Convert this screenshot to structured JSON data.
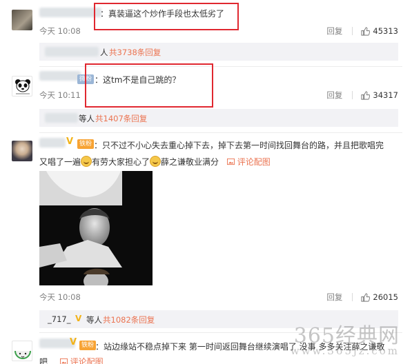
{
  "comments": [
    {
      "text": "：真装逼这个炒作手段也太低劣了",
      "timestamp": "今天 10:08",
      "reply_label": "回复",
      "likes": "45313",
      "subreply": {
        "prefix": "人",
        "count_text": "共3738条回复"
      }
    },
    {
      "badge": "微粉",
      "text": "：这tm不是自己跳的？",
      "timestamp": "今天 10:11",
      "reply_label": "回复",
      "likes": "34317",
      "subreply": {
        "prefix": "等人",
        "count_text": "共1407条回复"
      }
    },
    {
      "badge": "铁粉",
      "text_line1": "：只不过不小心失去重心掉下去，掉下去第一时间找回舞台的路，并且把歌唱完",
      "text_line2_a": "又唱了一遍",
      "text_line2_b": "有劳大家担心了",
      "text_line2_c": "薛之谦敬业满分",
      "pic_link": "评论配图",
      "timestamp": "今天 10:08",
      "reply_label": "回复",
      "likes": "26015",
      "subreply": {
        "user": "_717_",
        "prefix": "等人",
        "count_text": "共1082条回复"
      }
    },
    {
      "badge": "铁粉",
      "text": "：站边缘站不稳点掉下来 第一时间返回舞台继续演唱了 没事 多多关注薛之谦敬",
      "text_line2": "吧",
      "pic_link": "评论配图"
    }
  ],
  "watermark": {
    "main": "365经典网",
    "sub": "www.365jz.com"
  },
  "colors": {
    "highlight_box": "#e0272f",
    "link": "#eb7350",
    "badge": "#f7a334"
  }
}
